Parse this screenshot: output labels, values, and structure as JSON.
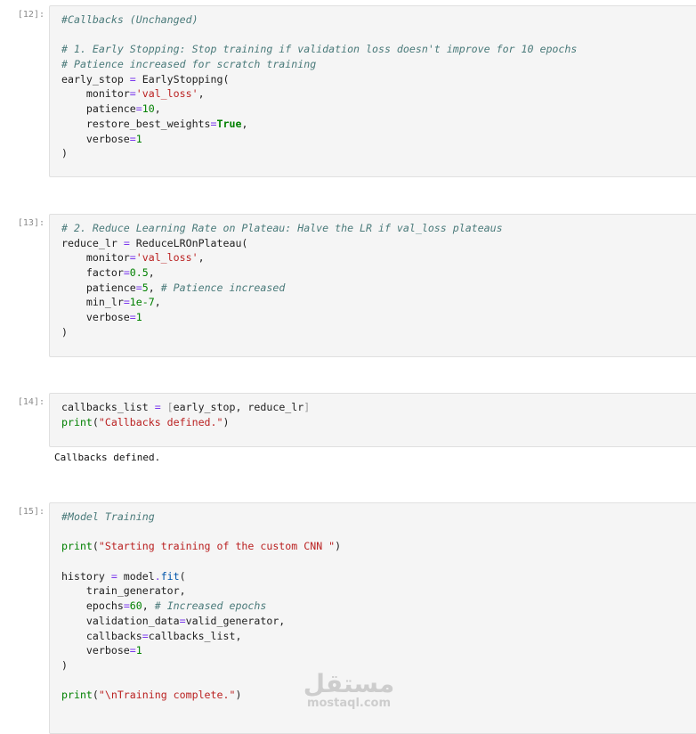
{
  "cells": [
    {
      "prompt": "[12]:",
      "lines": [
        [
          [
            "cm",
            "#Callbacks (Unchanged)"
          ]
        ],
        [],
        [
          [
            "cm",
            "# 1. Early Stopping: Stop training if validation loss doesn't improve for 10 epochs"
          ]
        ],
        [
          [
            "cm",
            "# Patience increased for scratch training"
          ]
        ],
        [
          [
            "t",
            "early_stop "
          ],
          [
            "op",
            "="
          ],
          [
            "t",
            " EarlyStopping("
          ]
        ],
        [
          [
            "t",
            "    monitor"
          ],
          [
            "op",
            "="
          ],
          [
            "str",
            "'val_loss'"
          ],
          [
            "t",
            ","
          ]
        ],
        [
          [
            "t",
            "    patience"
          ],
          [
            "op",
            "="
          ],
          [
            "num",
            "10"
          ],
          [
            "t",
            ","
          ]
        ],
        [
          [
            "t",
            "    restore_best_weights"
          ],
          [
            "op",
            "="
          ],
          [
            "kw",
            "True"
          ],
          [
            "t",
            ","
          ]
        ],
        [
          [
            "t",
            "    verbose"
          ],
          [
            "op",
            "="
          ],
          [
            "num",
            "1"
          ]
        ],
        [
          [
            "t",
            ")"
          ]
        ]
      ]
    },
    {
      "prompt": "[13]:",
      "lines": [
        [
          [
            "cm",
            "# 2. Reduce Learning Rate on Plateau: Halve the LR if val_loss plateaus"
          ]
        ],
        [
          [
            "t",
            "reduce_lr "
          ],
          [
            "op",
            "="
          ],
          [
            "t",
            " ReduceLROnPlateau("
          ]
        ],
        [
          [
            "t",
            "    monitor"
          ],
          [
            "op",
            "="
          ],
          [
            "str",
            "'val_loss'"
          ],
          [
            "t",
            ","
          ]
        ],
        [
          [
            "t",
            "    factor"
          ],
          [
            "op",
            "="
          ],
          [
            "num",
            "0.5"
          ],
          [
            "t",
            ","
          ]
        ],
        [
          [
            "t",
            "    patience"
          ],
          [
            "op",
            "="
          ],
          [
            "num",
            "5"
          ],
          [
            "t",
            ", "
          ],
          [
            "cm",
            "# Patience increased"
          ]
        ],
        [
          [
            "t",
            "    min_lr"
          ],
          [
            "op",
            "="
          ],
          [
            "num",
            "1e-7"
          ],
          [
            "t",
            ","
          ]
        ],
        [
          [
            "t",
            "    verbose"
          ],
          [
            "op",
            "="
          ],
          [
            "num",
            "1"
          ]
        ],
        [
          [
            "t",
            ")"
          ]
        ]
      ]
    },
    {
      "prompt": "[14]:",
      "lines": [
        [
          [
            "t",
            "callbacks_list "
          ],
          [
            "op",
            "="
          ],
          [
            "t",
            " "
          ],
          [
            "brk",
            "["
          ],
          [
            "t",
            "early_stop, reduce_lr"
          ],
          [
            "brk",
            "]"
          ]
        ],
        [
          [
            "builtin",
            "print"
          ],
          [
            "t",
            "("
          ],
          [
            "str",
            "\"Callbacks defined.\""
          ],
          [
            "t",
            ")"
          ]
        ]
      ],
      "output": "Callbacks defined."
    },
    {
      "prompt": "[15]:",
      "lines": [
        [
          [
            "cm",
            "#Model Training"
          ]
        ],
        [],
        [
          [
            "builtin",
            "print"
          ],
          [
            "t",
            "("
          ],
          [
            "str",
            "\"Starting training of the custom CNN \""
          ],
          [
            "t",
            ")"
          ]
        ],
        [],
        [
          [
            "t",
            "history "
          ],
          [
            "op",
            "="
          ],
          [
            "t",
            " model"
          ],
          [
            "op",
            "."
          ],
          [
            "fn",
            "fit"
          ],
          [
            "t",
            "("
          ]
        ],
        [
          [
            "t",
            "    train_generator,"
          ]
        ],
        [
          [
            "t",
            "    epochs"
          ],
          [
            "op",
            "="
          ],
          [
            "num",
            "60"
          ],
          [
            "t",
            ", "
          ],
          [
            "cm",
            "# Increased epochs"
          ]
        ],
        [
          [
            "t",
            "    validation_data"
          ],
          [
            "op",
            "="
          ],
          [
            "t",
            "valid_generator,"
          ]
        ],
        [
          [
            "t",
            "    callbacks"
          ],
          [
            "op",
            "="
          ],
          [
            "t",
            "callbacks_list,"
          ]
        ],
        [
          [
            "t",
            "    verbose"
          ],
          [
            "op",
            "="
          ],
          [
            "num",
            "1"
          ]
        ],
        [
          [
            "t",
            ")"
          ]
        ],
        [],
        [
          [
            "builtin",
            "print"
          ],
          [
            "t",
            "("
          ],
          [
            "str",
            "\"\\nTraining complete.\""
          ],
          [
            "t",
            ")"
          ]
        ]
      ]
    }
  ],
  "watermark": {
    "arabic": "مستقل",
    "latin": "mostaql.com"
  }
}
